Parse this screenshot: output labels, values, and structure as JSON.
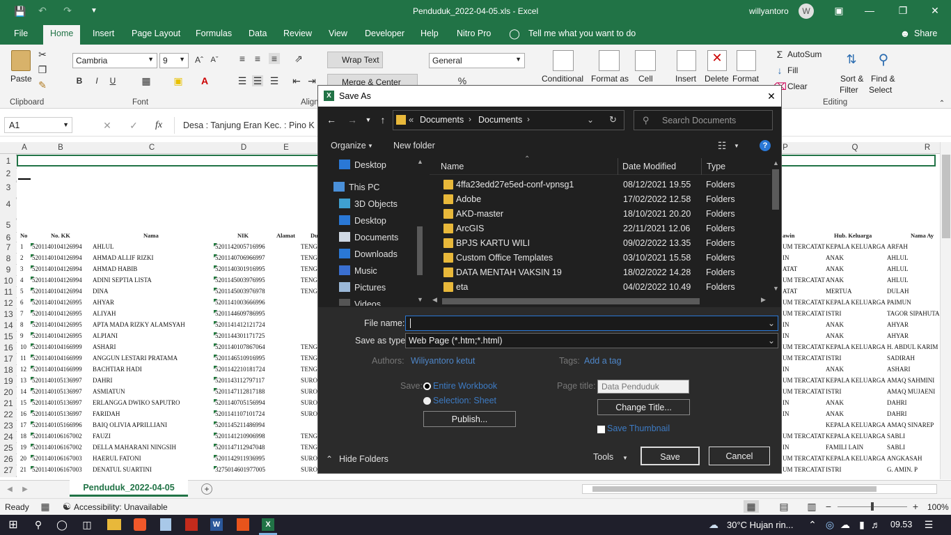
{
  "window": {
    "title": "Penduduk_2022-04-05.xls  -  Excel",
    "user": "willyantoro",
    "avatar_letter": "W"
  },
  "ribbon_tabs": [
    "File",
    "Home",
    "Insert",
    "Page Layout",
    "Formulas",
    "Data",
    "Review",
    "View",
    "Developer",
    "Help",
    "Nitro Pro",
    "Tell me what you want to do",
    "Share"
  ],
  "ribbon": {
    "paste": "Paste",
    "clipboard": "Clipboard",
    "font_name": "Cambria",
    "font_size": "9",
    "font": "Font",
    "wrap_text": "Wrap Text",
    "merge_center": "Merge & Center",
    "alignment": "Align",
    "number_format": "General",
    "conditional": "Conditional",
    "format_as": "Format as",
    "cell": "Cell",
    "insert": "Insert",
    "delete": "Delete",
    "format": "Format",
    "autosum": "AutoSum",
    "fill": "Fill",
    "clear": "Clear",
    "sort_filter": "Sort &",
    "filter": "Filter",
    "find_select": "Find &",
    "select": "Select",
    "editing": "Editing",
    "bold": "B",
    "italic": "I",
    "underline": "U"
  },
  "formula_bar": {
    "name_box": "A1",
    "formula": "Desa : Tanjung Eran Kec. : Pino K"
  },
  "columns": [
    "A",
    "B",
    "C",
    "D",
    "E",
    "P",
    "Q",
    "R"
  ],
  "rows": [
    "1",
    "2",
    "3",
    "4",
    "5",
    "6",
    "7",
    "8",
    "9",
    "10",
    "11",
    "12",
    "13",
    "14",
    "15",
    "16",
    "17",
    "18",
    "19",
    "20",
    "21",
    "22",
    "23",
    "24",
    "25",
    "26",
    "27"
  ],
  "table_headers": {
    "no": "No",
    "kk": "No. KK",
    "nama": "Nama",
    "nik": "NIK",
    "alamat": "Alamat",
    "du": "Du",
    "kawin": "awin",
    "hub": "Hub. Keluarga",
    "ayah": "Nama Ay"
  },
  "table_rows": [
    {
      "no": "1",
      "kk": "5201140104126994",
      "nama": "AHLUL",
      "nik": "5201142005716996",
      "alamat": "TENGA",
      "kawin": "UM TERCATAT",
      "hub": "KEPALA KELUARGA",
      "ayah": "ARFAH"
    },
    {
      "no": "2",
      "kk": "5201140104126994",
      "nama": "AHMAD ALLIF RIZKI",
      "nik": "5201140706966997",
      "alamat": "TENGA",
      "kawin": "IN",
      "hub": "ANAK",
      "ayah": "AHLUL"
    },
    {
      "no": "3",
      "kk": "5201140104126994",
      "nama": "AHMAD HABIB",
      "nik": "5201140301916995",
      "alamat": "TENGA",
      "kawin": "ATAT",
      "hub": "ANAK",
      "ayah": "AHLUL"
    },
    {
      "no": "4",
      "kk": "5201140104126994",
      "nama": "ADINI SEPTIA LISTA",
      "nik": "5201145003976995",
      "alamat": "TENGA",
      "kawin": "UM TERCATAT",
      "hub": "ANAK",
      "ayah": "AHLUL"
    },
    {
      "no": "5",
      "kk": "5201140104126994",
      "nama": "DINA",
      "nik": "5201145003976978",
      "alamat": "TENGA",
      "kawin": "ATAT",
      "hub": "MERTUA",
      "ayah": "DULAH"
    },
    {
      "no": "6",
      "kk": "5201140104126995",
      "nama": "AHYAR",
      "nik": "5201141003666996",
      "alamat": "",
      "kawin": "UM TERCATAT",
      "hub": "KEPALA KELUARGA",
      "ayah": "PAIMUN"
    },
    {
      "no": "7",
      "kk": "5201140104126995",
      "nama": "ALIYAH",
      "nik": "5201144609786995",
      "alamat": "",
      "kawin": "UM TERCATAT",
      "hub": "ISTRI",
      "ayah": "TAGOR SIPAHUTA"
    },
    {
      "no": "8",
      "kk": "5201140104126995",
      "nama": "APTA MADA RIZKY ALAMSYAH",
      "nik": "5201141412121724",
      "alamat": "",
      "kawin": "IN",
      "hub": "ANAK",
      "ayah": "AHYAR"
    },
    {
      "no": "9",
      "kk": "5201140104126995",
      "nama": "ALPIANI",
      "nik": "5201144301171725",
      "alamat": "",
      "kawin": "IN",
      "hub": "ANAK",
      "ayah": "AHYAR"
    },
    {
      "no": "10",
      "kk": "5201140104166999",
      "nama": "ASHARI",
      "nik": "5201140107867064",
      "alamat": "TENGA",
      "kawin": "UM TERCATAT",
      "hub": "KEPALA KELUARGA",
      "ayah": "H. ABDUL KARIM"
    },
    {
      "no": "11",
      "kk": "5201140104166999",
      "nama": "ANGGUN LESTARI PRATAMA",
      "nik": "5201146510916995",
      "alamat": "TENGA",
      "kawin": "UM TERCATAT",
      "hub": "ISTRI",
      "ayah": "SADIRAH"
    },
    {
      "no": "12",
      "kk": "5201140104166999",
      "nama": "BACHTIAR HADI",
      "nik": "5201142210181724",
      "alamat": "TENGA",
      "kawin": "IN",
      "hub": "ANAK",
      "ayah": "ASHARI"
    },
    {
      "no": "13",
      "kk": "5201140105136997",
      "nama": "DAHRI",
      "nik": "5201143112797117",
      "alamat": "SURO",
      "kawin": "UM TERCATAT",
      "hub": "KEPALA KELUARGA",
      "ayah": "AMAQ SAHMINI"
    },
    {
      "no": "14",
      "kk": "5201140105136997",
      "nama": "ASMIATUN",
      "nik": "5201147112817188",
      "alamat": "SURO",
      "kawin": "UM TERCATAT",
      "hub": "ISTRI",
      "ayah": "AMAQ MUJAENI"
    },
    {
      "no": "15",
      "kk": "5201140105136997",
      "nama": "ERLANGGA DWIKO SAPUTRO",
      "nik": "5201140705156994",
      "alamat": "SURO",
      "kawin": "IN",
      "hub": "ANAK",
      "ayah": "DAHRI"
    },
    {
      "no": "16",
      "kk": "5201140105136997",
      "nama": "FARIDAH",
      "nik": "5201141107101724",
      "alamat": "SURO",
      "kawin": "IN",
      "hub": "ANAK",
      "ayah": "DAHRI"
    },
    {
      "no": "17",
      "kk": "5201140105166996",
      "nama": "BAIQ OLIVIA APRILLIANI",
      "nik": "5201145211486994",
      "alamat": "",
      "kawin": "",
      "hub": "KEPALA KELUARGA",
      "ayah": "AMAQ SINAREP"
    },
    {
      "no": "18",
      "kk": "5201140106167002",
      "nama": "FAUZI",
      "nik": "5201141210906998",
      "alamat": "TENGA",
      "kawin": "UM TERCATAT",
      "hub": "KEPALA KELUARGA",
      "ayah": "SABLI"
    },
    {
      "no": "19",
      "kk": "5201140106167002",
      "nama": "DELLA MAHARANI NINGSIH",
      "nik": "5201147112947048",
      "alamat": "TENGA",
      "kawin": "IN",
      "hub": "FAMILI LAIN",
      "ayah": "SABLI"
    },
    {
      "no": "20",
      "kk": "5201140106167003",
      "nama": "HAERUL FATONI",
      "nik": "5201142911936995",
      "alamat": "SURO",
      "kawin": "UM TERCATAT",
      "hub": "KEPALA KELUARGA",
      "ayah": "ANGKASAH"
    },
    {
      "no": "21",
      "kk": "5201140106167003",
      "nama": "DENATUL SUARTINI",
      "nik": "3275014601977005",
      "alamat": "SURO",
      "kawin": "UM TERCATAT",
      "hub": "ISTRI",
      "ayah": "G. AMIN. P"
    }
  ],
  "dialog": {
    "title": "Save As",
    "breadcrumb": [
      "Documents",
      "Documents"
    ],
    "search_placeholder": "Search Documents",
    "organize": "Organize",
    "new_folder": "New folder",
    "nav": [
      "Desktop",
      "This PC",
      "3D Objects",
      "Desktop",
      "Documents",
      "Downloads",
      "Music",
      "Pictures",
      "Videos"
    ],
    "columns": [
      "Name",
      "Date Modified",
      "Type"
    ],
    "files": [
      {
        "name": "4ffa23edd27e5ed-conf-vpnsg1",
        "date": "08/12/2021 19.55",
        "type": "Folders"
      },
      {
        "name": "Adobe",
        "date": "17/02/2022 12.58",
        "type": "Folders"
      },
      {
        "name": "AKD-master",
        "date": "18/10/2021 20.20",
        "type": "Folders"
      },
      {
        "name": "ArcGIS",
        "date": "22/11/2021 12.06",
        "type": "Folders"
      },
      {
        "name": "BPJS KARTU WILI",
        "date": "09/02/2022 13.35",
        "type": "Folders"
      },
      {
        "name": "Custom Office Templates",
        "date": "03/10/2021 15.58",
        "type": "Folders"
      },
      {
        "name": "DATA MENTAH VAKSIN 19",
        "date": "18/02/2022 14.28",
        "type": "Folders"
      },
      {
        "name": "eta",
        "date": "04/02/2022 10.49",
        "type": "Folders"
      }
    ],
    "file_name_label": "File name:",
    "file_name_value": "",
    "save_type_label": "Save as type:",
    "save_type_value": "Web Page (*.htm;*.html)",
    "authors_label": "Authors:",
    "authors_value": "Wiliyantoro ketut",
    "tags_label": "Tags:",
    "tags_value": "Add a tag",
    "save_label": "Save:",
    "entire_workbook": "Entire Workbook",
    "selection_sheet": "Selection: Sheet",
    "publish": "Publish...",
    "page_title_label": "Page title:",
    "page_title_value": "Data Penduduk",
    "change_title": "Change Title...",
    "save_thumbnail": "Save Thumbnail",
    "hide_folders": "Hide Folders",
    "tools": "Tools",
    "save_button": "Save",
    "cancel_button": "Cancel"
  },
  "sheet_tab": "Penduduk_2022-04-05",
  "status": {
    "ready": "Ready",
    "accessibility": "Accessibility: Unavailable",
    "zoom": "100%"
  },
  "taskbar": {
    "weather": "30°C  Hujan rin...",
    "time": "09.53"
  }
}
